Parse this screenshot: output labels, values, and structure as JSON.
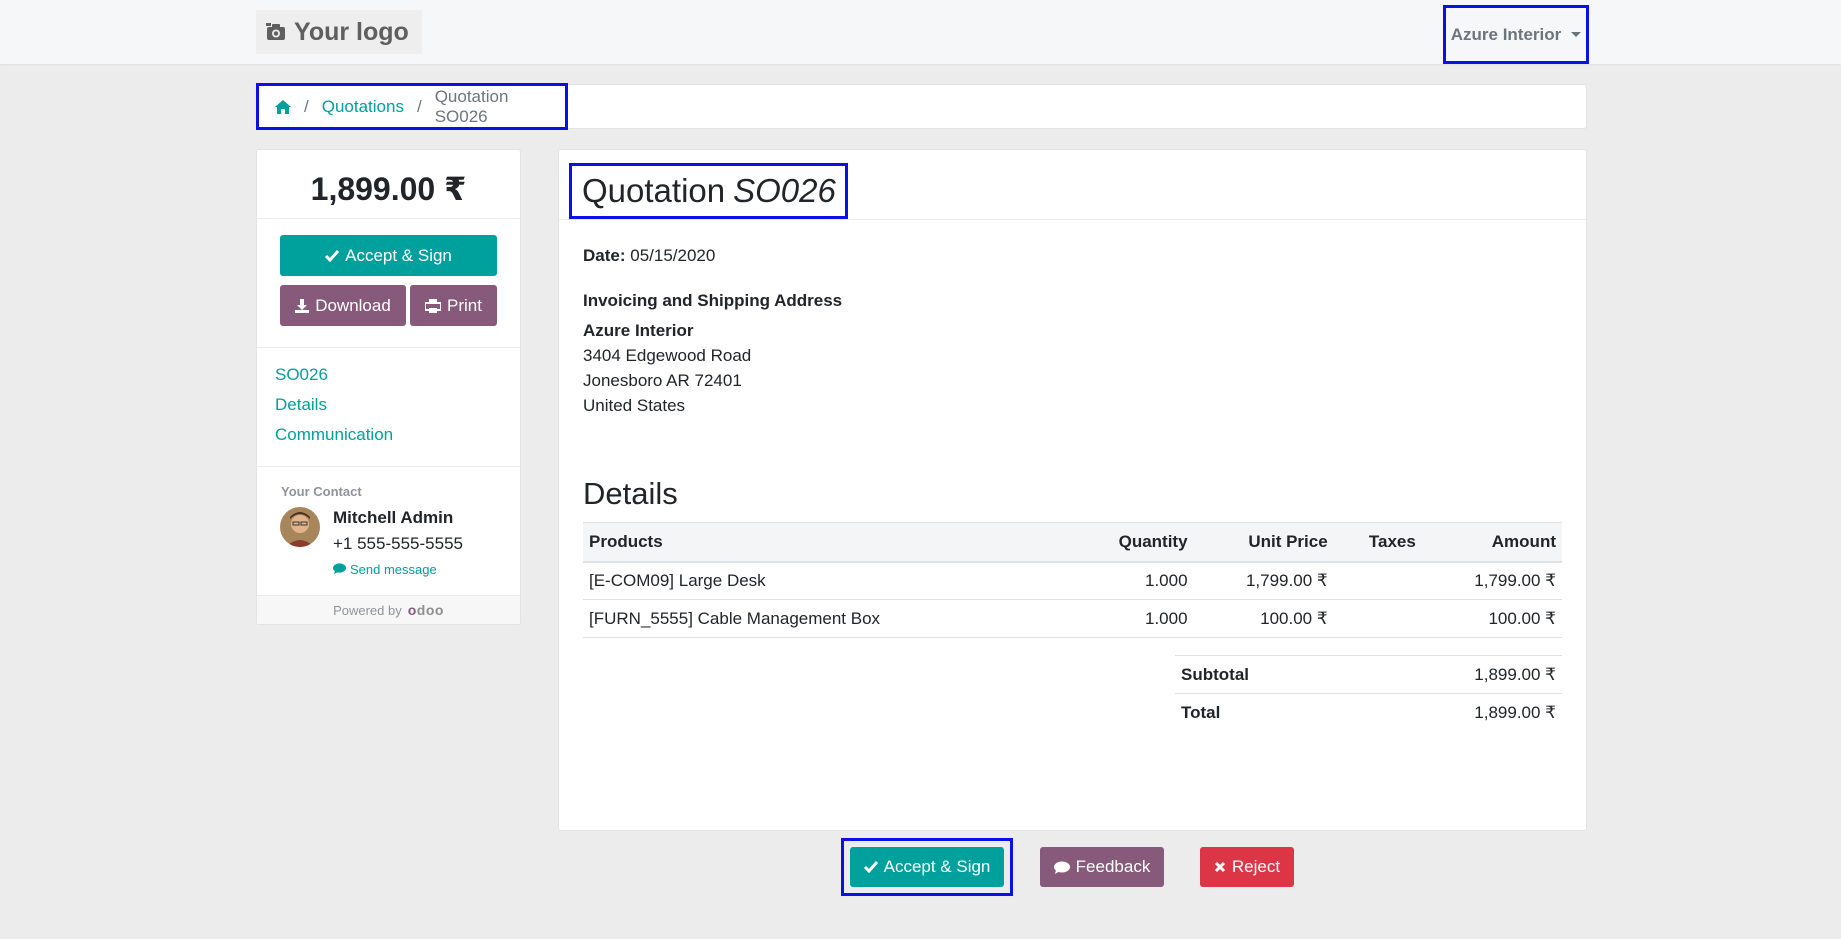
{
  "header": {
    "logo_text": "Your logo",
    "user_menu": "Azure Interior"
  },
  "breadcrumb": {
    "home_icon": "home-icon",
    "items": [
      "Quotations",
      "Quotation SO026"
    ]
  },
  "sidebar": {
    "amount": "1,899.00 ₹",
    "accept_sign": "Accept & Sign",
    "download": "Download",
    "print": "Print",
    "nav": [
      "SO026",
      "Details",
      "Communication"
    ],
    "contact_title": "Your Contact",
    "contact_name": "Mitchell Admin",
    "contact_phone": "+1 555-555-5555",
    "send_message": "Send message",
    "powered_by": "Powered by",
    "powered_brand": "odoo"
  },
  "main": {
    "title_prefix": "Quotation",
    "title_number": "SO026",
    "date_label": "Date:",
    "date_value": "05/15/2020",
    "address_heading": "Invoicing and Shipping Address",
    "address_name": "Azure Interior",
    "address_lines": [
      "3404 Edgewood Road",
      "Jonesboro AR 72401",
      "United States"
    ],
    "details_heading": "Details",
    "table": {
      "headers": [
        "Products",
        "Quantity",
        "Unit Price",
        "Taxes",
        "Amount"
      ],
      "rows": [
        [
          "[E-COM09] Large Desk",
          "1.000",
          "1,799.00 ₹",
          "",
          "1,799.00 ₹"
        ],
        [
          "[FURN_5555] Cable Management Box",
          "1.000",
          "100.00 ₹",
          "",
          "100.00 ₹"
        ]
      ]
    },
    "subtotal_label": "Subtotal",
    "subtotal_value": "1,899.00 ₹",
    "total_label": "Total",
    "total_value": "1,899.00 ₹"
  },
  "actions": {
    "accept_sign": "Accept & Sign",
    "feedback": "Feedback",
    "reject": "Reject"
  },
  "colors": {
    "primary": "#00a09d",
    "secondary": "#875a7b",
    "danger": "#dc3545",
    "highlight": "#0b10e6"
  }
}
